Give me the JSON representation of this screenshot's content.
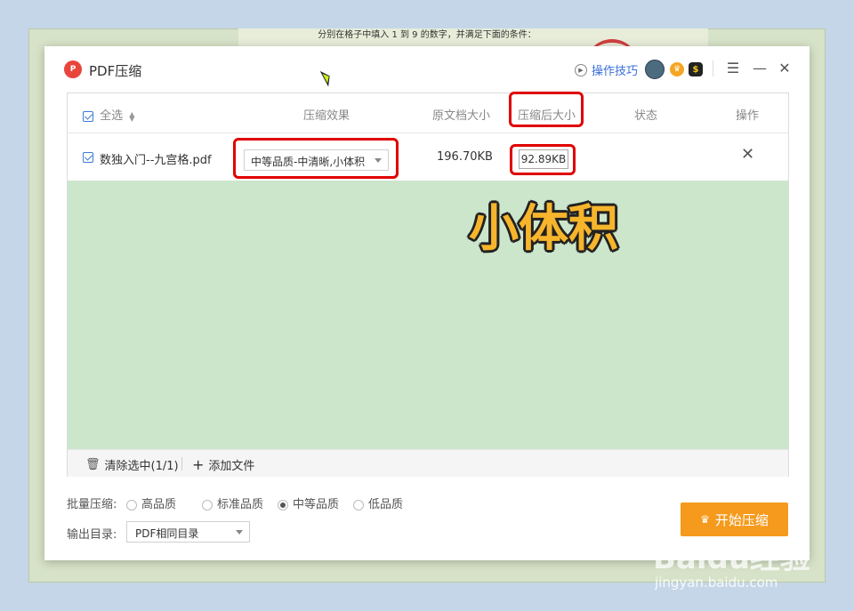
{
  "background": {
    "text": "分别在格子中填入 1 到 9 的数字，并满足下面的条件："
  },
  "app": {
    "logo_text": "P",
    "title": "PDF压缩",
    "help_label": "操作技巧"
  },
  "table": {
    "select_all": "全选",
    "columns": {
      "effect": "压缩效果",
      "original_size": "原文档大小",
      "compressed_size": "压缩后大小",
      "status": "状态",
      "action": "操作"
    },
    "rows": [
      {
        "filename": "数独入门--九宫格.pdf",
        "quality": "中等品质-中清晰,小体积",
        "original_size": "196.70KB",
        "compressed_size": "92.89KB",
        "status": ""
      }
    ]
  },
  "footer": {
    "clear_selected": "清除选中(1/1)",
    "add_file": "添加文件"
  },
  "batch": {
    "label": "批量压缩:",
    "options": [
      "高品质",
      "标准品质",
      "中等品质",
      "低品质"
    ],
    "selected": "中等品质"
  },
  "output": {
    "label": "输出目录:",
    "value": "PDF相同目录"
  },
  "start_button": "开始压缩",
  "annotation": "小体积",
  "watermark": {
    "main": "Baidu经验",
    "url": "jingyan.baidu.com"
  },
  "colors": {
    "accent": "#f59a1c",
    "highlight": "#e00000",
    "list_bg": "#cce6cc",
    "link": "#3a6fd8"
  }
}
